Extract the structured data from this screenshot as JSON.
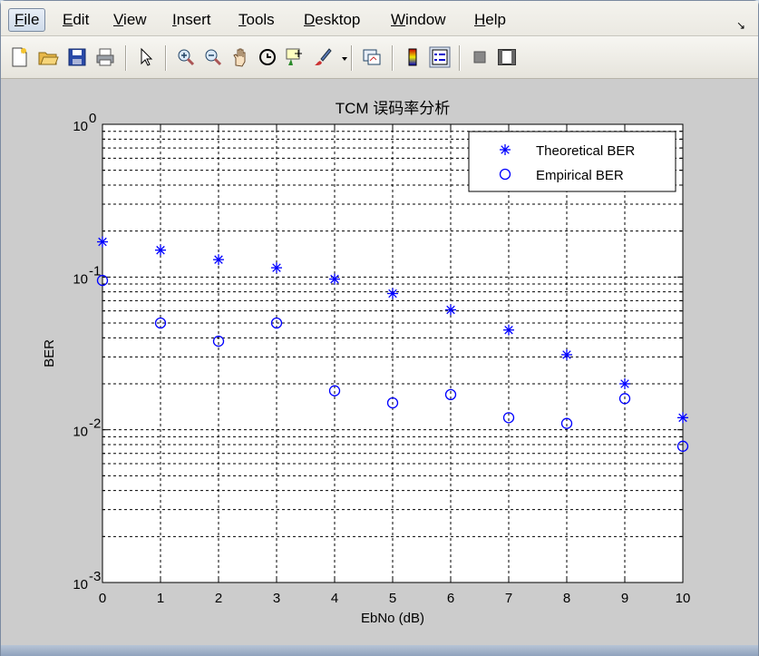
{
  "menubar": {
    "items": [
      {
        "key": "F",
        "rest": "ile"
      },
      {
        "key": "E",
        "rest": "dit"
      },
      {
        "key": "V",
        "rest": "iew"
      },
      {
        "key": "I",
        "rest": "nsert"
      },
      {
        "key": "T",
        "rest": "ools"
      },
      {
        "key": "D",
        "rest": "esktop"
      },
      {
        "key": "W",
        "rest": "indow"
      },
      {
        "key": "H",
        "rest": "elp"
      }
    ],
    "dock_arrow": "↘"
  },
  "toolbar": {
    "icons": [
      "new-figure-icon",
      "open-file-icon",
      "save-icon",
      "print-icon",
      "pointer-icon",
      "zoom-in-icon",
      "zoom-out-icon",
      "pan-hand-icon",
      "rotate-3d-icon",
      "data-cursor-icon",
      "brush-icon",
      "link-plot-icon",
      "colorbar-icon",
      "legend-icon",
      "hide-plot-tools-icon",
      "show-plot-tools-icon"
    ]
  },
  "colors": {
    "series": "#0000ff",
    "axes_bg": "#ffffff",
    "figure_bg": "#cccccc"
  },
  "chart_data": {
    "type": "scatter",
    "title": "TCM 误码率分析",
    "xlabel": "EbNo (dB)",
    "ylabel": "BER",
    "xlim": [
      0,
      10
    ],
    "ylim": [
      0.001,
      1
    ],
    "yscale": "log",
    "grid": true,
    "legend_position": "top-right",
    "x_ticks": [
      "0",
      "1",
      "2",
      "3",
      "4",
      "5",
      "6",
      "7",
      "8",
      "9",
      "10"
    ],
    "y_ticks": [
      {
        "base": "10",
        "exp": "-3"
      },
      {
        "base": "10",
        "exp": "-2"
      },
      {
        "base": "10",
        "exp": "-1"
      },
      {
        "base": "10",
        "exp": "0"
      }
    ],
    "x": [
      0,
      1,
      2,
      3,
      4,
      5,
      6,
      7,
      8,
      9,
      10
    ],
    "series": [
      {
        "name": "Theoretical BER",
        "marker": "*",
        "values": [
          0.17,
          0.15,
          0.13,
          0.115,
          0.097,
          0.078,
          0.061,
          0.045,
          0.031,
          0.02,
          0.012
        ]
      },
      {
        "name": "Empirical BER",
        "marker": "o",
        "values": [
          0.095,
          0.05,
          0.038,
          0.05,
          0.018,
          0.015,
          0.017,
          0.012,
          0.011,
          0.016,
          0.0078
        ]
      }
    ]
  }
}
